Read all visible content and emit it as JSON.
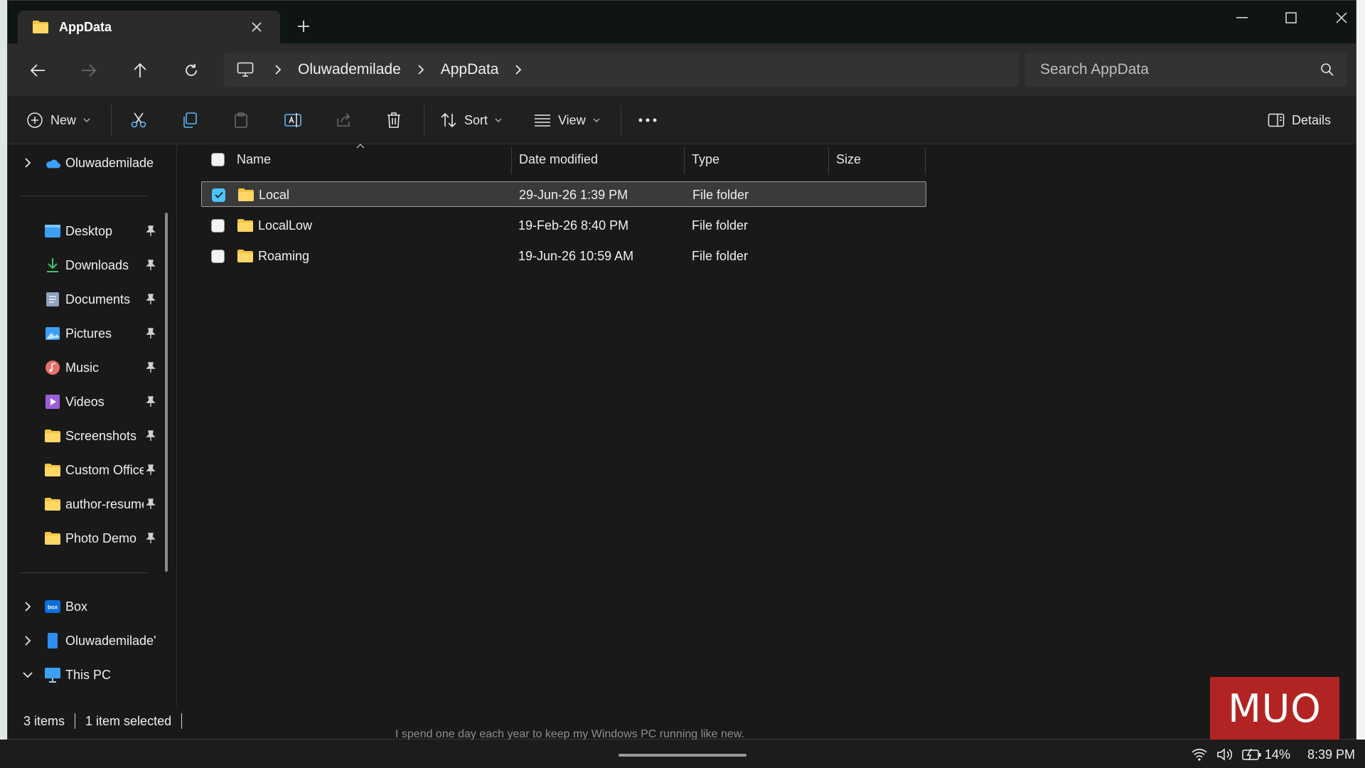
{
  "window": {
    "tab_title": "AppData"
  },
  "nav": {
    "breadcrumbs": [
      "Oluwademilade",
      "AppData"
    ],
    "search_placeholder": "Search AppData"
  },
  "toolbar": {
    "new_label": "New",
    "sort_label": "Sort",
    "view_label": "View",
    "details_label": "Details"
  },
  "sidebar": {
    "top_item": "Oluwademilade",
    "pinned": [
      {
        "label": "Desktop",
        "icon": "desktop-icon"
      },
      {
        "label": "Downloads",
        "icon": "downloads-icon"
      },
      {
        "label": "Documents",
        "icon": "documents-icon"
      },
      {
        "label": "Pictures",
        "icon": "pictures-icon"
      },
      {
        "label": "Music",
        "icon": "music-icon"
      },
      {
        "label": "Videos",
        "icon": "videos-icon"
      },
      {
        "label": "Screenshots",
        "icon": "folder-icon"
      },
      {
        "label": "Custom Office Templates",
        "icon": "folder-icon"
      },
      {
        "label": "author-resume",
        "icon": "folder-icon"
      },
      {
        "label": "Photo Demo",
        "icon": "folder-icon"
      }
    ],
    "bottom": [
      {
        "label": "Box",
        "icon": "box-icon",
        "expanded": false
      },
      {
        "label": "Oluwademilade'",
        "icon": "phone-icon",
        "expanded": false
      },
      {
        "label": "This PC",
        "icon": "pc-icon",
        "expanded": true
      }
    ]
  },
  "files": {
    "columns": [
      "Name",
      "Date modified",
      "Type",
      "Size"
    ],
    "rows": [
      {
        "name": "Local",
        "date": "29-Jun-26 1:39 PM",
        "type": "File folder",
        "size": "",
        "selected": true
      },
      {
        "name": "LocalLow",
        "date": "19-Feb-26 8:40 PM",
        "type": "File folder",
        "size": "",
        "selected": false
      },
      {
        "name": "Roaming",
        "date": "19-Jun-26 10:59 AM",
        "type": "File folder",
        "size": "",
        "selected": false
      }
    ]
  },
  "status": {
    "item_count": "3 items",
    "selection": "1 item selected"
  },
  "background_text": "I spend one day each year to keep my Windows PC running like new.",
  "tray": {
    "battery": "14%",
    "time": "8:39 PM"
  },
  "watermark": "MUO",
  "colors": {
    "accent": "#4cc2ff",
    "folder": "#f5c542",
    "watermark": "#c72624"
  }
}
